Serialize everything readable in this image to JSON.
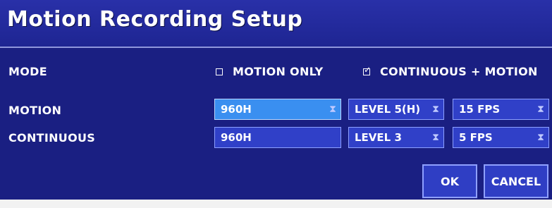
{
  "dialog": {
    "title": "Motion Recording Setup"
  },
  "mode": {
    "label": "MODE",
    "options": [
      {
        "label": "MOTION ONLY",
        "checked": false
      },
      {
        "label": "CONTINUOUS + MOTION",
        "checked": true
      }
    ],
    "check_glyph": "✓"
  },
  "motion": {
    "label": "MOTION",
    "resolution": "960H",
    "quality": "LEVEL 5(H)",
    "fps": "15 FPS"
  },
  "continuous": {
    "label": "CONTINUOUS",
    "resolution": "960H",
    "quality": "LEVEL 3",
    "fps": "5 FPS"
  },
  "buttons": {
    "ok": "OK",
    "cancel": "CANCEL"
  },
  "colors": {
    "background": "#1a1f82",
    "field": "#3040c8",
    "field_selected": "#3a8ff0"
  },
  "icons": {
    "spinner": "⧗"
  }
}
